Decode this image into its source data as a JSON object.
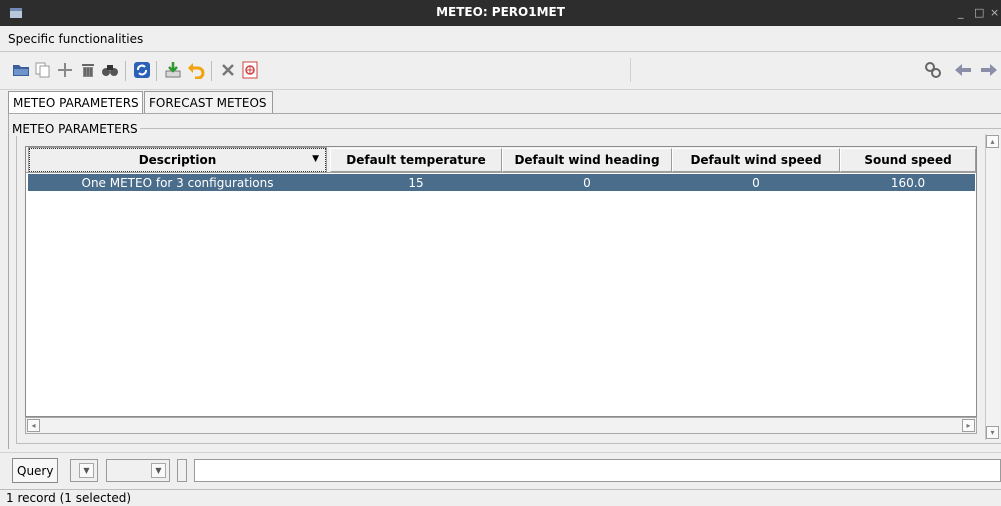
{
  "window": {
    "title": "METEO: PERO1MET",
    "minimize": "_",
    "maximize": "□",
    "close": "×"
  },
  "menu": {
    "label": "Specific functionalities"
  },
  "toolbar": {
    "icons": [
      "open-folder-icon",
      "duplicate-icon",
      "add-icon",
      "delete-icon",
      "search-icon",
      "refresh-icon",
      "save-icon",
      "undo-icon",
      "clear-icon",
      "print-icon",
      "options-icon",
      "prev-arrow-icon",
      "next-arrow-icon"
    ]
  },
  "tabs": [
    {
      "label": "METEO PARAMETERS",
      "active": true
    },
    {
      "label": "FORECAST METEOS",
      "active": false
    }
  ],
  "group": {
    "label": "METEO PARAMETERS"
  },
  "grid": {
    "columns": [
      "Description",
      "Default temperature",
      "Default wind heading",
      "Default wind speed",
      "Sound speed"
    ],
    "sort_glyph": "▼",
    "rows": [
      {
        "description": "One METEO for 3 configurations",
        "temperature": "15",
        "wind_heading": "0",
        "wind_speed": "0",
        "sound_speed": "160.0",
        "selected": true
      }
    ]
  },
  "query": {
    "button": "Query"
  },
  "status": {
    "text": "1 record (1 selected)"
  },
  "colors": {
    "selection": "#4a6d8c",
    "titlebar": "#2d2d2d"
  }
}
